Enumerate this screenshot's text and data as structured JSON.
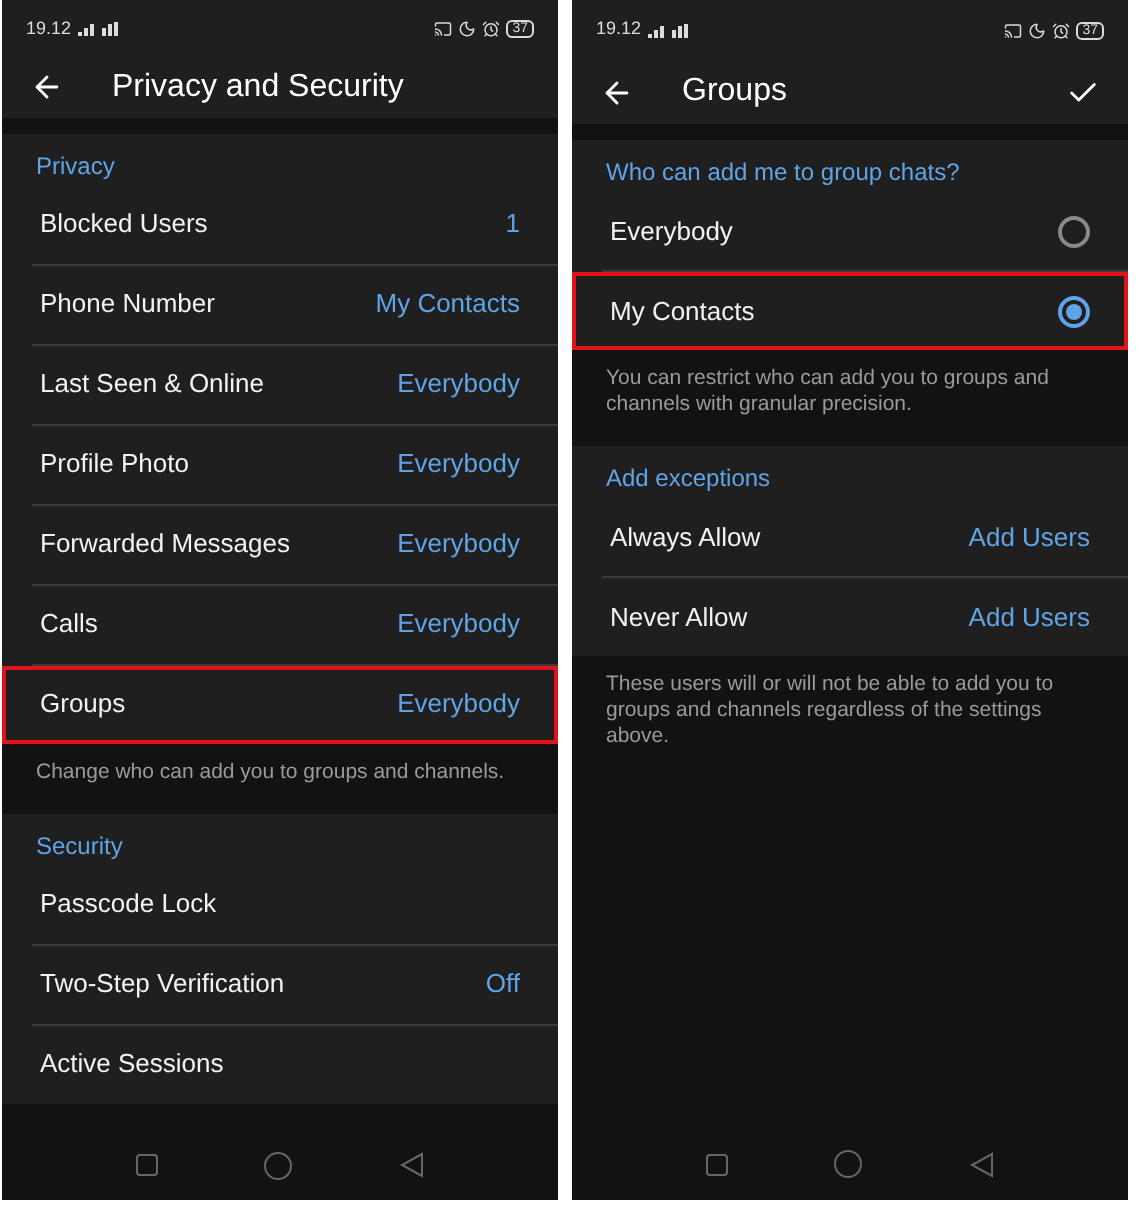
{
  "screens": [
    {
      "status_bar": {
        "time": "19.12",
        "battery": "37"
      },
      "header": {
        "title": "Privacy and Security",
        "confirm": false
      },
      "sections": [
        {
          "title": "Privacy",
          "rows": [
            {
              "kind": "value",
              "label": "Blocked Users",
              "value": "1",
              "highlighted": false
            },
            {
              "kind": "value",
              "label": "Phone Number",
              "value": "My Contacts",
              "highlighted": false
            },
            {
              "kind": "value",
              "label": "Last Seen & Online",
              "value": "Everybody",
              "highlighted": false
            },
            {
              "kind": "value",
              "label": "Profile Photo",
              "value": "Everybody",
              "highlighted": false
            },
            {
              "kind": "value",
              "label": "Forwarded Messages",
              "value": "Everybody",
              "highlighted": false
            },
            {
              "kind": "value",
              "label": "Calls",
              "value": "Everybody",
              "highlighted": false
            },
            {
              "kind": "value",
              "label": "Groups",
              "value": "Everybody",
              "highlighted": true
            }
          ],
          "footer": "Change who can add you to groups and channels."
        },
        {
          "title": "Security",
          "rows": [
            {
              "kind": "value",
              "label": "Passcode Lock",
              "highlighted": false
            },
            {
              "kind": "value",
              "label": "Two-Step Verification",
              "value": "Off",
              "highlighted": false
            },
            {
              "kind": "value",
              "label": "Active Sessions",
              "highlighted": false
            }
          ]
        }
      ]
    },
    {
      "status_bar": {
        "time": "19.12",
        "battery": "37"
      },
      "header": {
        "title": "Groups",
        "confirm": true
      },
      "sections": [
        {
          "title": "Who can add me to group chats?",
          "rows": [
            {
              "kind": "radio",
              "label": "Everybody",
              "selected": false,
              "highlighted": false
            },
            {
              "kind": "radio",
              "label": "My Contacts",
              "selected": true,
              "highlighted": true
            }
          ],
          "footer": "You can restrict who can add you to groups and channels with granular precision."
        },
        {
          "title": "Add exceptions",
          "rows": [
            {
              "kind": "value",
              "label": "Always Allow",
              "value": "Add Users",
              "highlighted": false
            },
            {
              "kind": "value",
              "label": "Never Allow",
              "value": "Add Users",
              "highlighted": false
            }
          ],
          "footer": "These users will or will not be able to add you to groups and channels regardless of the settings above."
        }
      ]
    }
  ]
}
